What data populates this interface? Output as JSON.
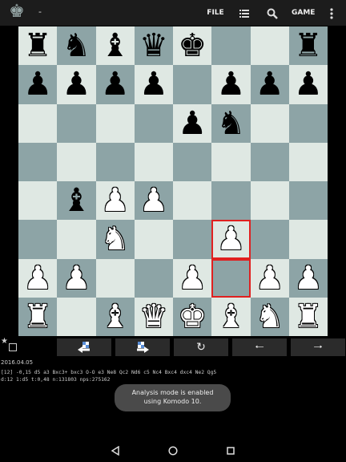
{
  "appbar": {
    "title": "-",
    "file_label": "FILE",
    "game_label": "GAME",
    "icons": {
      "app": "king-icon",
      "list": "list-icon",
      "search": "search-icon",
      "menu": "overflow-menu-icon"
    }
  },
  "colors": {
    "light_square": "#dfe8e3",
    "dark_square": "#8da4a6",
    "highlight": "#e02020"
  },
  "board": {
    "rows": [
      [
        "bR",
        "bN",
        "bB",
        "bQ",
        "bK",
        "",
        "",
        "bR"
      ],
      [
        "bP",
        "bP",
        "bP",
        "bP",
        "",
        "bP",
        "bP",
        "bP"
      ],
      [
        "",
        "",
        "",
        "",
        "bP",
        "bN",
        "",
        ""
      ],
      [
        "",
        "",
        "",
        "",
        "",
        "",
        "",
        ""
      ],
      [
        "",
        "bB",
        "wP",
        "wP",
        "",
        "",
        "",
        ""
      ],
      [
        "",
        "",
        "wN",
        "",
        "",
        "wP",
        "",
        ""
      ],
      [
        "wP",
        "wP",
        "",
        "",
        "wP",
        "",
        "wP",
        "wP"
      ],
      [
        "wR",
        "",
        "wB",
        "wQ",
        "wK",
        "wB",
        "wN",
        "wR"
      ]
    ],
    "highlighted": [
      "f3",
      "f2"
    ]
  },
  "nav": [
    {
      "name": "go-back-variation-button",
      "icon": "back-variation-icon"
    },
    {
      "name": "go-forward-variation-button",
      "icon": "forward-variation-icon"
    },
    {
      "name": "flip-board-button",
      "icon": "flip-icon"
    },
    {
      "name": "undo-move-button",
      "icon": "arrow-left-icon"
    },
    {
      "name": "redo-move-button",
      "icon": "arrow-right-icon"
    }
  ],
  "game": {
    "date": "2016.04.05",
    "analysis_line1": "[12] -0,15 d5 a3 Bxc3+ bxc3 O-O e3 Ne8 Qc2 Nd6 c5 Nc4 Bxc4 dxc4 Ne2 Qg5",
    "analysis_line2": "d:12 1:d5 t:0,48 n:131803 nps:275162"
  },
  "toast": {
    "message": "Analysis mode is enabled using Komodo 10."
  }
}
